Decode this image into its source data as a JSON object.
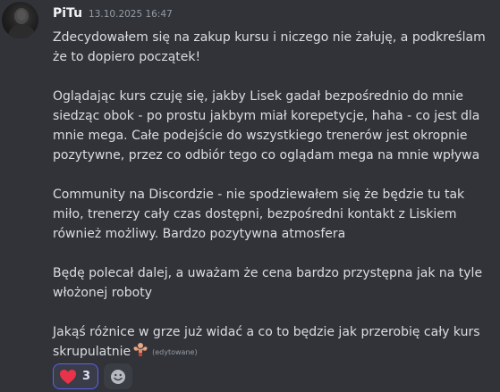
{
  "message": {
    "author": "PiTu",
    "timestamp": "13.10.2025 16:47",
    "paragraphs": [
      "Zdecydowałem się na zakup kursu i niczego nie żałuję, a podkreślam że to dopiero początek!",
      "Oglądając kurs czuję się, jakby Lisek gadał bezpośrednio do mnie siedząc obok - po prostu jakbym miał korepetycje, haha - co jest dla mnie mega. Całe podejście do wszystkiego trenerów jest okropnie pozytywne, przez co odbiór tego co oglądam mega na mnie wpływa",
      "Community na Discordzie - nie spodziewałem się że będzie tu tak miło, trenerzy cały czas dostępni, bezpośredni kontakt z Liskiem również możliwy. Bardzo pozytywna atmosfera",
      "Będę polecał dalej, a uważam że cena bardzo przystępna jak na tyle włożonej roboty"
    ],
    "last_paragraph": "Jakąś różnice w grze już widać a co to będzie jak przerobię cały kurs skrupulatnie",
    "inline_emoji": "flexed-biceps-emoji",
    "edited_label": "(edytowane)"
  },
  "reactions": [
    {
      "icon": "heart-icon",
      "count": "3",
      "color": "#e8334a"
    }
  ],
  "add_reaction": {
    "icon": "smile-add-reaction-icon"
  },
  "colors": {
    "background": "#323339",
    "text": "#dbdee1",
    "muted": "#949ba4",
    "accent": "#5865f2"
  }
}
